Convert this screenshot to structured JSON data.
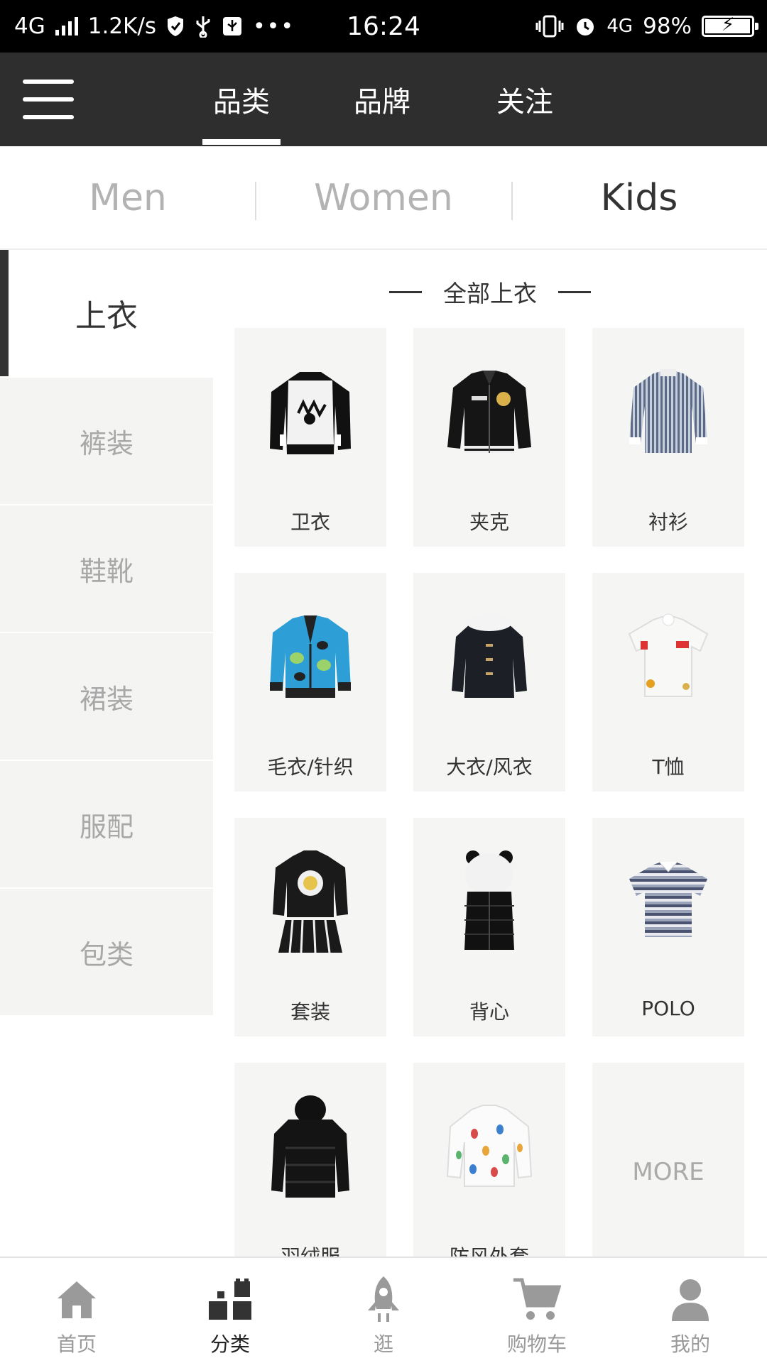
{
  "status_bar": {
    "network": "4G",
    "speed": "1.2K/s",
    "time": "16:24",
    "network_right": "4G",
    "battery": "98%",
    "battery_level": 0.98
  },
  "header": {
    "tabs": [
      {
        "label": "品类",
        "active": true
      },
      {
        "label": "品牌",
        "active": false
      },
      {
        "label": "关注",
        "active": false
      }
    ]
  },
  "gender_tabs": [
    {
      "label": "Men",
      "active": false
    },
    {
      "label": "Women",
      "active": false
    },
    {
      "label": "Kids",
      "active": true
    }
  ],
  "sidebar": {
    "items": [
      {
        "label": "上衣",
        "active": true
      },
      {
        "label": "裤装",
        "active": false
      },
      {
        "label": "鞋靴",
        "active": false
      },
      {
        "label": "裙装",
        "active": false
      },
      {
        "label": "服配",
        "active": false
      },
      {
        "label": "包类",
        "active": false
      }
    ]
  },
  "content": {
    "section_title": "全部上衣",
    "items": [
      {
        "label": "卫衣",
        "icon": "sweatshirt"
      },
      {
        "label": "夹克",
        "icon": "jacket"
      },
      {
        "label": "衬衫",
        "icon": "shirt"
      },
      {
        "label": "毛衣/针织",
        "icon": "cardigan"
      },
      {
        "label": "大衣/风衣",
        "icon": "coat"
      },
      {
        "label": "T恤",
        "icon": "tshirt"
      },
      {
        "label": "套装",
        "icon": "outfit-set"
      },
      {
        "label": "背心",
        "icon": "vest"
      },
      {
        "label": "POLO",
        "icon": "polo"
      },
      {
        "label": "羽绒服",
        "icon": "down-jacket"
      },
      {
        "label": "防风外套",
        "icon": "windbreaker"
      }
    ],
    "more_label": "MORE"
  },
  "bottom_nav": [
    {
      "label": "首页",
      "icon": "home-icon",
      "active": false
    },
    {
      "label": "分类",
      "icon": "category-icon",
      "active": true
    },
    {
      "label": "逛",
      "icon": "rocket-icon",
      "active": false
    },
    {
      "label": "购物车",
      "icon": "cart-icon",
      "active": false
    },
    {
      "label": "我的",
      "icon": "user-icon",
      "active": false
    }
  ]
}
